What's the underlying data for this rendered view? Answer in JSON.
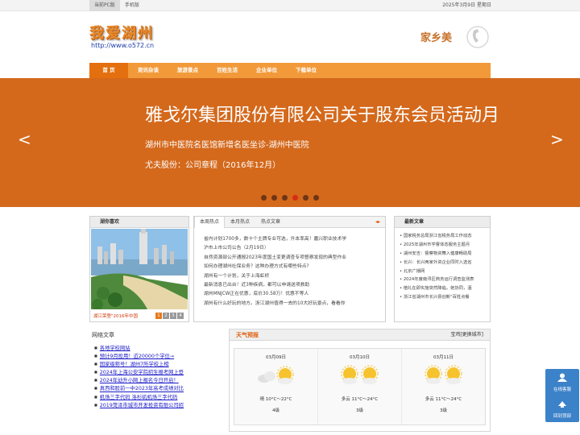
{
  "topbar": {
    "tabs": [
      "当前PC版",
      "手机版"
    ],
    "date": "2025年3月9日 星期日"
  },
  "header": {
    "logo_text": "我爱湖州",
    "url": "http://www.o572.cn",
    "slogan": "家乡美"
  },
  "nav": {
    "items": [
      "首 页",
      "资讯杂谈",
      "旅游景点",
      "百姓生活",
      "企业单位",
      "下载单位"
    ]
  },
  "banner": {
    "headline": "雅戈尔集团股份有限公司关于股东会员活动月",
    "line2": "湖州市中医院名医馆新增名医坐诊-湖州中医院",
    "line3": "尤夫股份：公司章程（2016年12月）",
    "prev_arrow": "<",
    "next_arrow": ">",
    "slide_count": 6,
    "active_slide": 4
  },
  "photo_box": {
    "title": "湖你喜欢",
    "caption": "湖江荣登\"2016年中国",
    "pages": [
      "1",
      "2",
      "3",
      "4"
    ],
    "active_page": "1"
  },
  "tabs_box": {
    "tabs": [
      "本周热点",
      "本月热点",
      "热点文章"
    ],
    "arrows": "◂▸",
    "items": [
      "省内计划1700多，数十个主牌专业可选，升本率高！嘉兴职业技术学",
      "沪市上市公司公告（2月19日）",
      "自然资源部公开通报2023年度国土变更调查专项督察发现的典型作业",
      "如何办理湖州社保业务？这种办理方式有哪些特点?",
      "湖州有一个计划，关于上海虹桥",
      "最新消息已出台！近3种疾病，都可以申请送项救助",
      "湖州MNJCW正在优惠，底价30.58万！优惠不等人",
      "湖州有什么好玩的地方。浙江湖州值得一去的10大好玩景点，看看你"
    ]
  },
  "news_box": {
    "title": "最新文章",
    "items": [
      "国家税务总局浙江省税务局工作动态",
      "2025年湖州市学督体态服务主题月",
      "湖州安吉：督察物资舞入健康畅助局",
      "长兴：长兴两家外资企业同时入选省",
      "北京广播网",
      "2024年度南浔区商务运行调查监测表",
      "植礼在即实施突然降临，她协同，酒",
      "浙江省湖州市长兴县创新\"百姓点餐"
    ]
  },
  "links_box": {
    "title": "网络文章",
    "items": [
      "各地学校网站",
      "预计9月投用！近20000个学位→",
      "国家级称号！湖州7所学校上榜",
      "2024年上海公安学院招生报考网上登",
      "2024年幼升小网上报名今日开启！",
      "真西和股前一中2023年高考成绩对比",
      "机场三字代码 洛杉矶机场三字代码",
      "2019菏泽市城市开发投资有限公司招"
    ]
  },
  "weather": {
    "title": "天气预报",
    "city": "宝鸡[更换城市]",
    "days": [
      {
        "date": "03月09日",
        "desc": "晴 10°C～22°C",
        "level": "4级",
        "icon": "sun-cloud-icon"
      },
      {
        "date": "03月10日",
        "desc": "多云 11°C～24°C",
        "level": "3级",
        "icon": "sun-cloud-icon"
      },
      {
        "date": "03月11日",
        "desc": "多云 11°C～24°C",
        "level": "3级",
        "icon": "sun-cloud-icon"
      }
    ]
  },
  "floating": {
    "consult": "在线客服",
    "top": "回到顶部"
  }
}
